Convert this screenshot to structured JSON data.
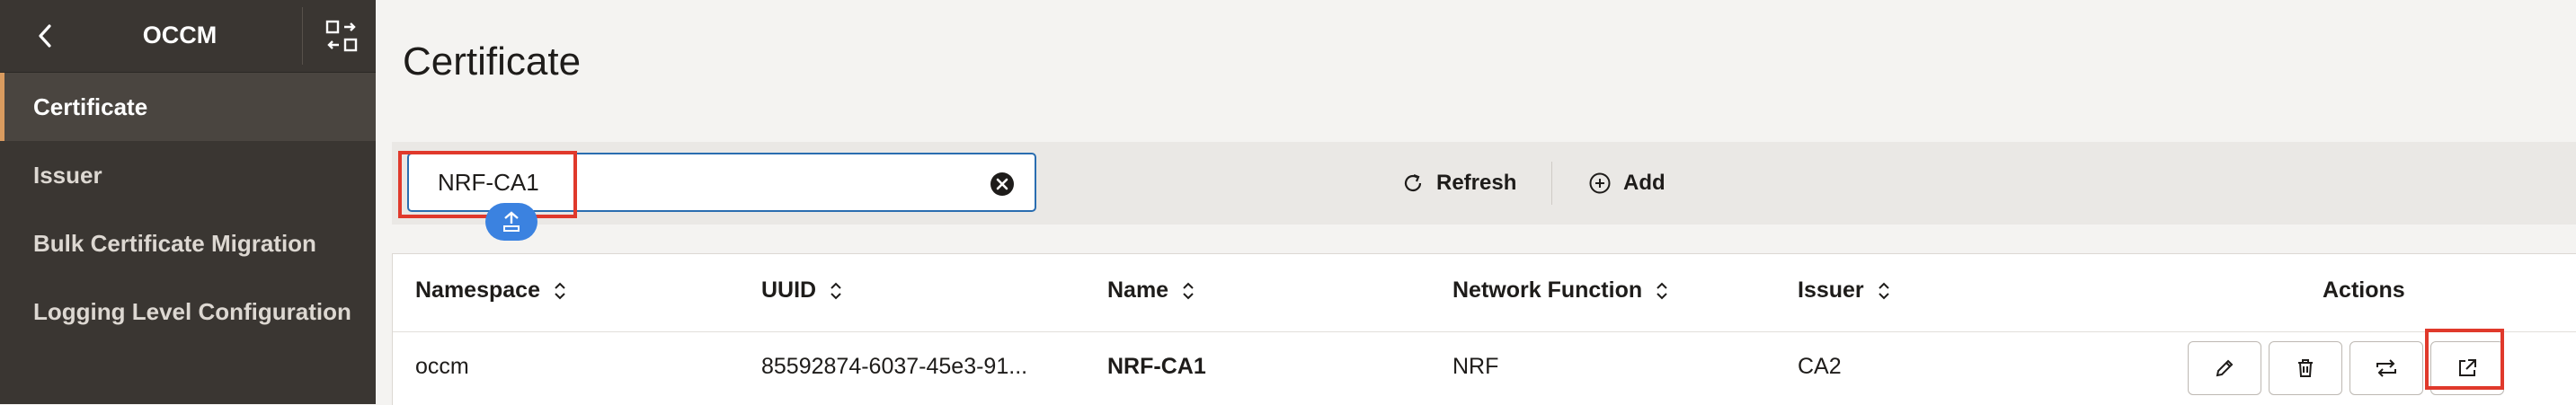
{
  "app": {
    "title": "OCCM"
  },
  "sidebar": {
    "items": [
      {
        "label": "Certificate",
        "active": true
      },
      {
        "label": "Issuer"
      },
      {
        "label": "Bulk Certificate Migration"
      },
      {
        "label": "Logging Level Configuration"
      }
    ]
  },
  "page": {
    "title": "Certificate"
  },
  "search": {
    "value": "NRF-CA1",
    "placeholder": ""
  },
  "toolbar": {
    "refresh_label": "Refresh",
    "add_label": "Add"
  },
  "table": {
    "columns": [
      "Namespace",
      "UUID",
      "Name",
      "Network Function",
      "Issuer",
      "Actions"
    ],
    "rows": [
      {
        "namespace": "occm",
        "uuid": "85592874-6037-45e3-91...",
        "name": "NRF-CA1",
        "network_function": "NRF",
        "issuer": "CA2"
      }
    ]
  },
  "icons": {
    "back": "chevron-left-icon",
    "collapse": "collapse-panel-icon",
    "clear": "clear-x-icon",
    "refresh": "refresh-icon",
    "add": "add-circle-icon",
    "sort": "sort-icon",
    "edit": "pencil-icon",
    "delete": "trash-icon",
    "renew": "renew-icon",
    "open": "open-external-icon"
  },
  "colors": {
    "sidebar_bg": "#3a3632",
    "accent": "#d99b5f",
    "highlight": "#e0392b",
    "focus": "#2a6db0"
  }
}
